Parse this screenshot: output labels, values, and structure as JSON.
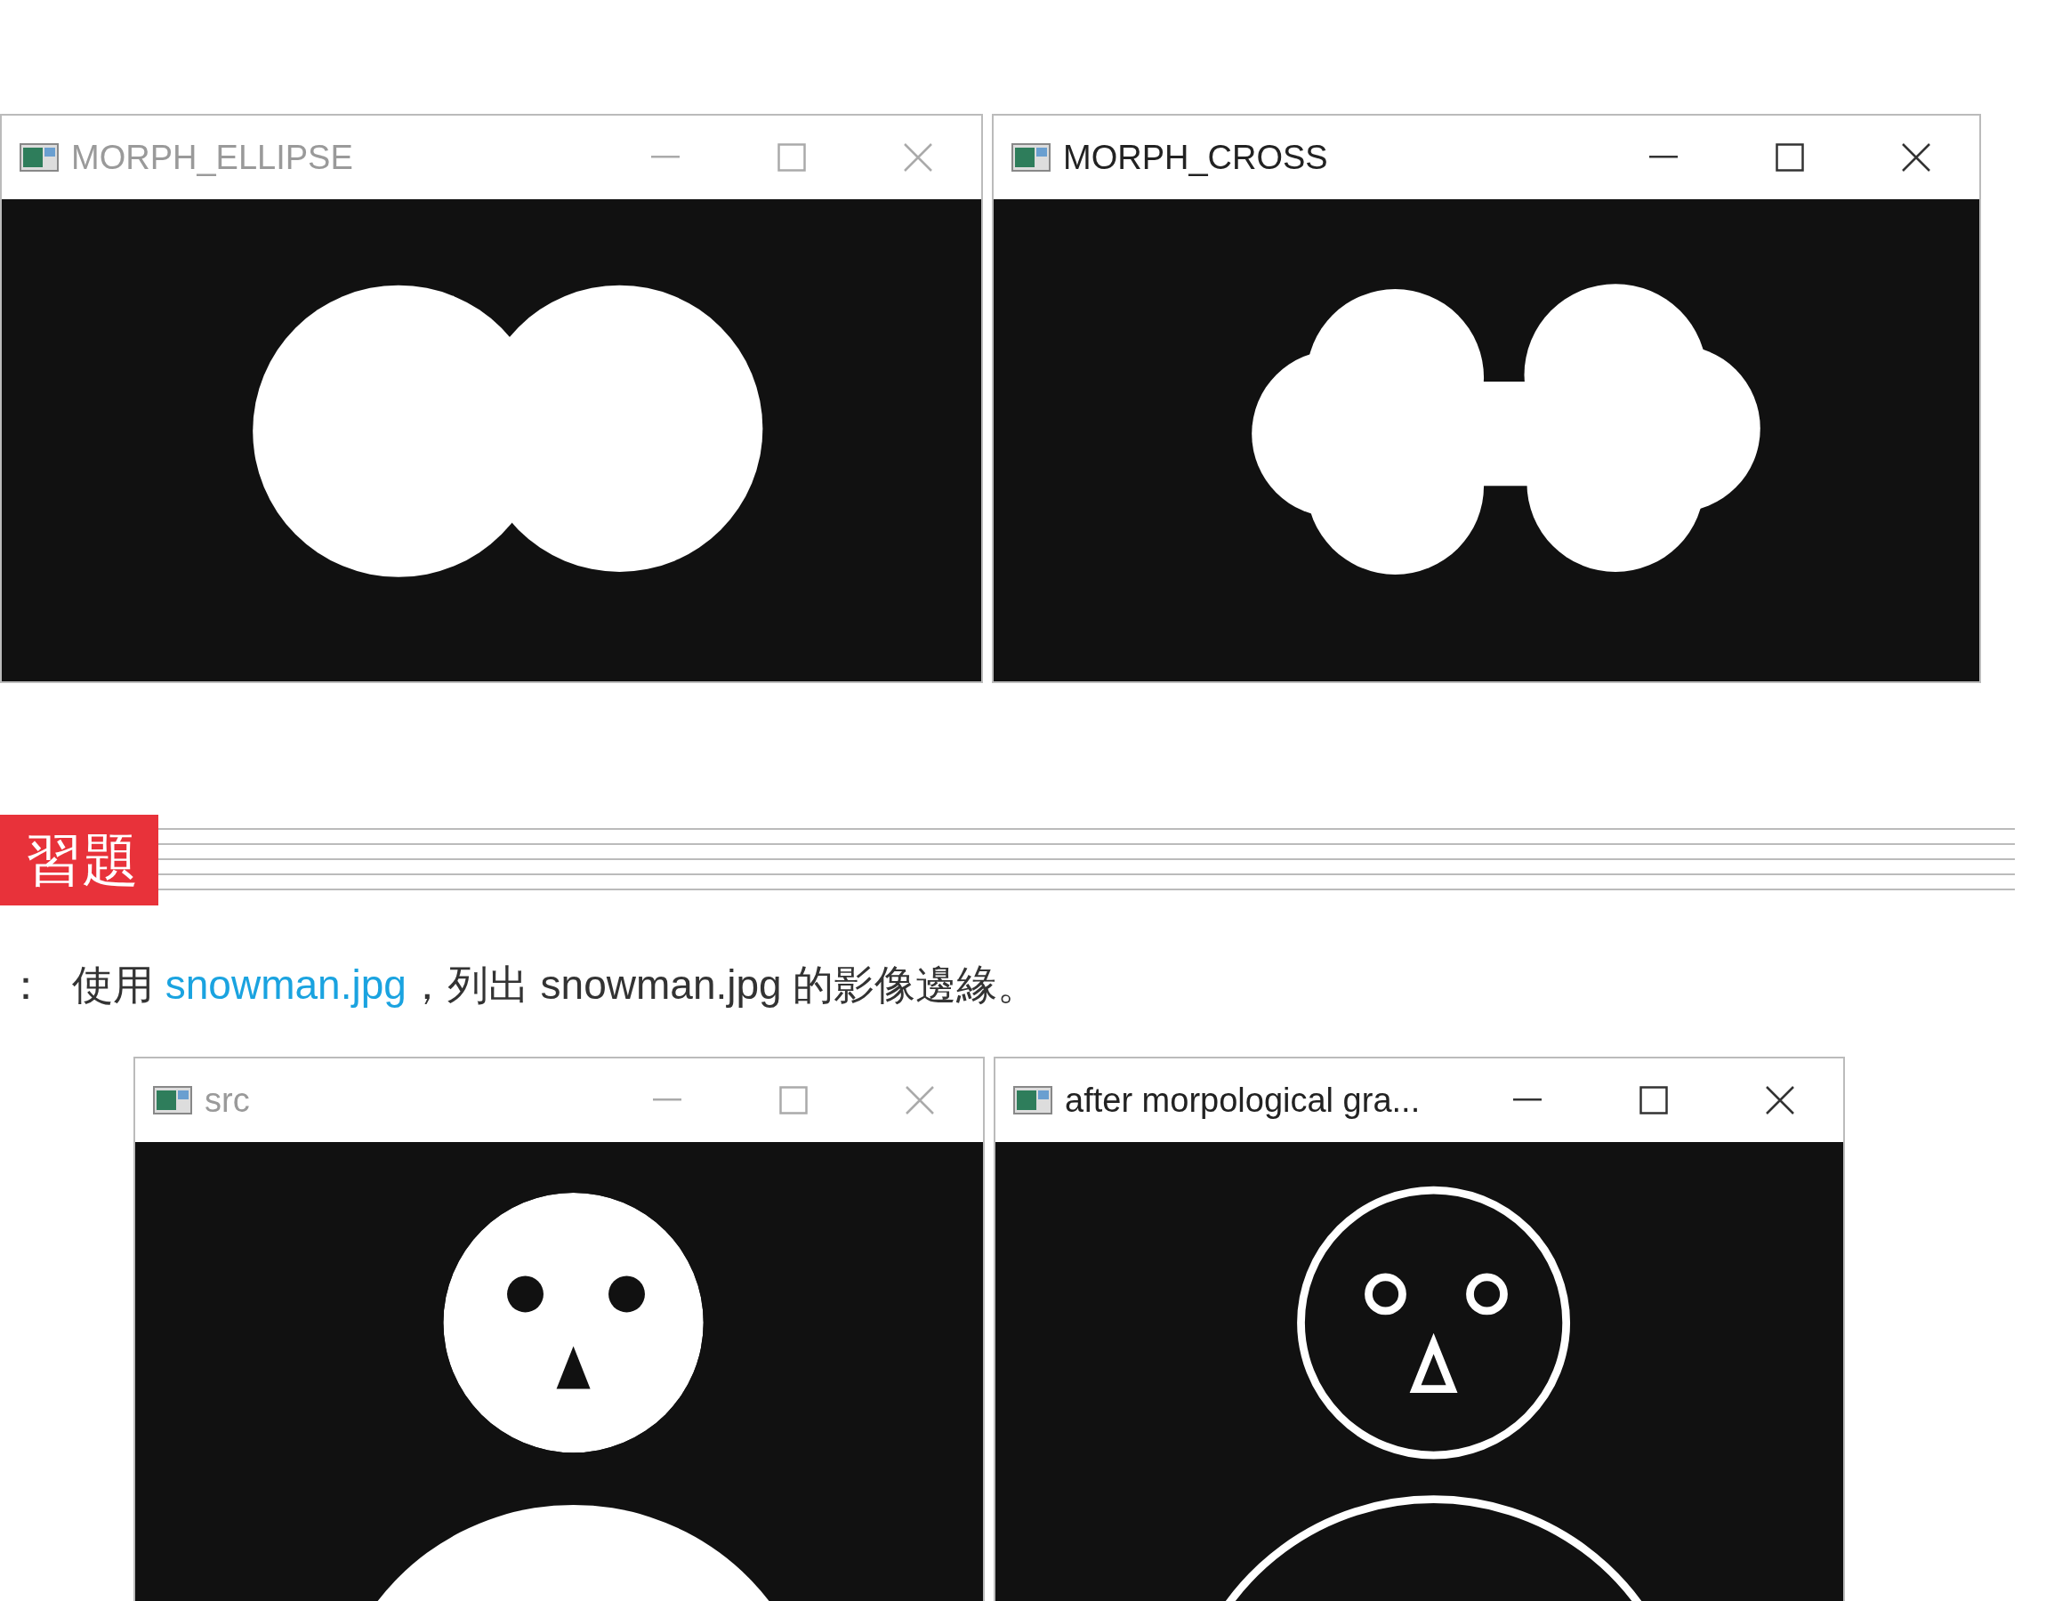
{
  "top_windows": [
    {
      "title": "MORPH_ELLIPSE",
      "active": false,
      "kind": "ellipse"
    },
    {
      "title": "MORPH_CROSS",
      "active": true,
      "kind": "cross"
    }
  ],
  "section_badge": "習題",
  "exercise": {
    "marker": "：",
    "before": "使用 ",
    "link": "snowman.jpg",
    "after": "，列出 snowman.jpg 的影像邊緣。"
  },
  "bottom_windows": [
    {
      "title": "src",
      "active": false,
      "kind": "snowman"
    },
    {
      "title": "after morpological gra...",
      "active": true,
      "kind": "gradient"
    }
  ]
}
